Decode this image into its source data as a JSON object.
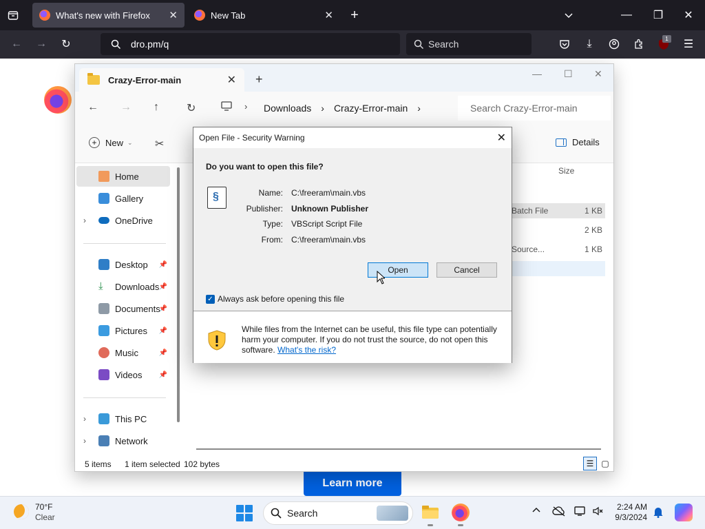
{
  "browser": {
    "tabs": [
      {
        "title": "What's new with Firefox",
        "active": true
      },
      {
        "title": "New Tab",
        "active": false
      }
    ],
    "url": "dro.pm/q",
    "search_placeholder": "Search",
    "ublock_badge": "1",
    "page": {
      "learn_more": "Learn more"
    }
  },
  "explorer": {
    "tab_title": "Crazy-Error-main",
    "breadcrumbs": [
      "Downloads",
      "Crazy-Error-main"
    ],
    "search_placeholder": "Search Crazy-Error-main",
    "toolbar": {
      "new_label": "New",
      "details_label": "Details"
    },
    "sidebar": {
      "group1": [
        "Home",
        "Gallery",
        "OneDrive"
      ],
      "group2": [
        "Desktop",
        "Downloads",
        "Documents",
        "Pictures",
        "Music",
        "Videos"
      ],
      "group3": [
        "This PC",
        "Network"
      ]
    },
    "columns": {
      "size": "Size"
    },
    "rows": [
      {
        "type": "Batch File",
        "size": "1 KB"
      },
      {
        "type": "",
        "size": "2 KB"
      },
      {
        "type": "Source...",
        "size": "1 KB"
      }
    ],
    "status": {
      "items": "5 items",
      "selected": "1 item selected",
      "bytes": "102 bytes"
    }
  },
  "dialog": {
    "title": "Open File - Security Warning",
    "question": "Do you want to open this file?",
    "labels": {
      "name": "Name:",
      "publisher": "Publisher:",
      "type": "Type:",
      "from": "From:"
    },
    "values": {
      "name": "C:\\freeram\\main.vbs",
      "publisher": "Unknown Publisher",
      "type": "VBScript Script File",
      "from": "C:\\freeram\\main.vbs"
    },
    "open_label": "Open",
    "cancel_label": "Cancel",
    "checkbox_label": "Always ask before opening this file",
    "warning_text": "While files from the Internet can be useful, this file type can potentially harm your computer. If you do not trust the source, do not open this software. ",
    "risk_link": "What's the risk?"
  },
  "taskbar": {
    "weather": {
      "temp": "70°F",
      "condition": "Clear"
    },
    "search_placeholder": "Search",
    "time": "2:24 AM",
    "date": "9/3/2024"
  }
}
